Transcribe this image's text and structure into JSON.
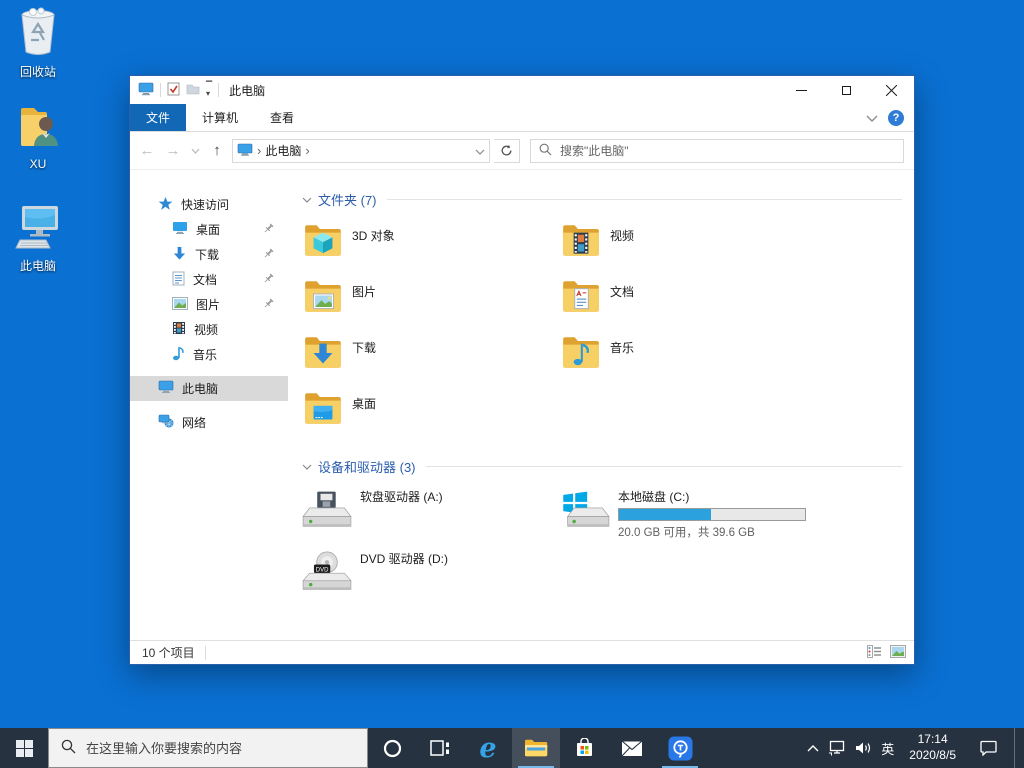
{
  "desktop": {
    "icons": [
      {
        "label": "回收站"
      },
      {
        "label": "XU"
      },
      {
        "label": "此电脑"
      }
    ]
  },
  "window": {
    "titlebar": {
      "title": "此电脑"
    },
    "menu": {
      "tabs": [
        {
          "label": "文件"
        },
        {
          "label": "计算机"
        },
        {
          "label": "查看"
        }
      ]
    },
    "addressbar": {
      "breadcrumb": "此电脑"
    },
    "search": {
      "placeholder": "搜索\"此电脑\""
    },
    "sidebar": {
      "items": [
        {
          "label": "快速访问"
        },
        {
          "label": "桌面",
          "pinned": true
        },
        {
          "label": "下载",
          "pinned": true
        },
        {
          "label": "文档",
          "pinned": true
        },
        {
          "label": "图片",
          "pinned": true
        },
        {
          "label": "视频"
        },
        {
          "label": "音乐"
        },
        {
          "label": "此电脑",
          "selected": true
        },
        {
          "label": "网络"
        }
      ]
    },
    "content": {
      "groups": [
        {
          "title": "文件夹 (7)",
          "items": [
            {
              "label": "3D 对象"
            },
            {
              "label": "视频"
            },
            {
              "label": "图片"
            },
            {
              "label": "文档"
            },
            {
              "label": "下载"
            },
            {
              "label": "音乐"
            },
            {
              "label": "桌面"
            }
          ]
        },
        {
          "title": "设备和驱动器 (3)",
          "items": [
            {
              "label": "软盘驱动器 (A:)"
            },
            {
              "label": "本地磁盘 (C:)",
              "capacity_text": "20.0 GB 可用，共 39.6 GB",
              "used_percent": 49.5
            },
            {
              "label": "DVD 驱动器 (D:)"
            }
          ]
        }
      ]
    },
    "statusbar": {
      "count": "10 个项目"
    }
  },
  "taskbar": {
    "search": {
      "placeholder": "在这里输入你要搜索的内容"
    },
    "tray": {
      "ime": "英",
      "time": "17:14",
      "date": "2020/8/5"
    }
  },
  "colors": {
    "desktop_background": "#0a70d2",
    "taskbar_background": "#273240",
    "file_tab_blue": "#1268b5",
    "disk_usage_bar": "#2ba2dd",
    "group_header_blue": "#2b5dad"
  }
}
